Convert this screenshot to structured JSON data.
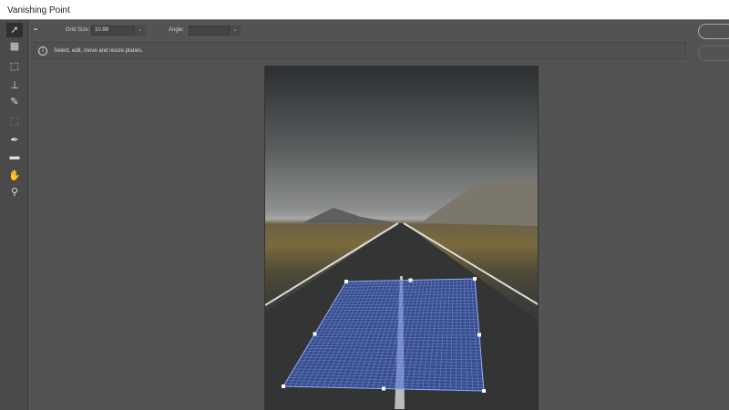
{
  "window": {
    "title": "Vanishing Point"
  },
  "tools": [
    {
      "name": "edit-plane-tool",
      "icon": "arrow-pointer-icon",
      "active": true
    },
    {
      "name": "create-plane-tool",
      "icon": "grid-plane-icon"
    },
    {
      "name": "marquee-tool",
      "icon": "marquee-icon"
    },
    {
      "name": "stamp-tool",
      "icon": "stamp-icon"
    },
    {
      "name": "brush-tool",
      "icon": "brush-icon"
    },
    {
      "name": "transform-tool",
      "icon": "transform-icon"
    },
    {
      "name": "eyedropper-tool",
      "icon": "eyedropper-icon"
    },
    {
      "name": "measure-tool",
      "icon": "ruler-icon"
    },
    {
      "name": "hand-tool",
      "icon": "hand-icon"
    },
    {
      "name": "zoom-tool",
      "icon": "zoom-icon"
    }
  ],
  "options": {
    "grid_size_label": "Grid Size:",
    "grid_size_value": "10.99",
    "angle_label": "Angle:",
    "angle_value": ""
  },
  "info": {
    "message": "Select, edit, move and resize planes."
  },
  "colors": {
    "grid": "#3a5fd0",
    "background": "#535353"
  }
}
